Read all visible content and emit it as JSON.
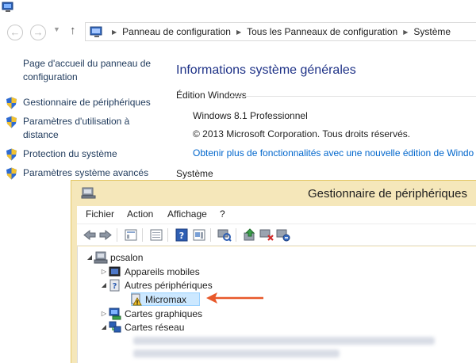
{
  "control_panel": {
    "breadcrumb": [
      "Panneau de configuration",
      "Tous les Panneaux de configuration",
      "Système"
    ],
    "home_link": "Page d'accueil du panneau de configuration",
    "tasks": [
      {
        "label": "Gestionnaire de périphériques",
        "icon": "uac-shield-icon"
      },
      {
        "label": "Paramètres d'utilisation à distance",
        "icon": "uac-shield-icon"
      },
      {
        "label": "Protection du système",
        "icon": "uac-shield-icon"
      },
      {
        "label": "Paramètres système avancés",
        "icon": "uac-shield-icon"
      }
    ],
    "main_title": "Informations système générales",
    "edition_label": "Édition Windows",
    "os_name": "Windows 8.1 Professionnel",
    "copyright": "© 2013 Microsoft Corporation. Tous droits réservés.",
    "more_features_link": "Obtenir plus de fonctionnalités avec une nouvelle édition de Windo",
    "system_label": "Système"
  },
  "device_manager": {
    "title": "Gestionnaire de périphériques",
    "menu": [
      "Fichier",
      "Action",
      "Affichage",
      "?"
    ],
    "toolbar_icons": [
      "back-icon",
      "forward-icon",
      "properties-icon",
      "show-hide-icon",
      "help-icon",
      "details-icon",
      "scan-hardware-icon",
      "update-driver-icon",
      "disable-device-icon",
      "uninstall-icon"
    ],
    "tree": {
      "root": "pcsalon",
      "nodes": [
        {
          "label": "Appareils mobiles",
          "expander": "expand"
        },
        {
          "label": "Autres périphériques",
          "expander": "collapse"
        },
        {
          "label": "Micromax",
          "child": true,
          "warning": true,
          "selected": true
        },
        {
          "label": "Cartes graphiques",
          "expander": "expand"
        },
        {
          "label": "Cartes réseau",
          "expander": "collapse"
        }
      ]
    },
    "annotation_color": "#e8582a"
  }
}
